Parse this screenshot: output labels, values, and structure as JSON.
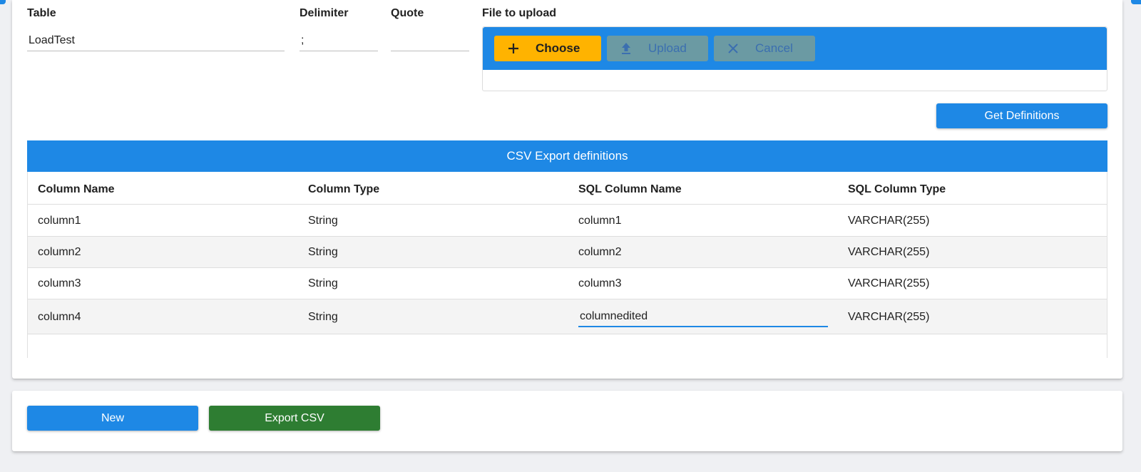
{
  "form": {
    "table_label": "Table",
    "table_value": "LoadTest",
    "delimiter_label": "Delimiter",
    "delimiter_value": ";",
    "quote_label": "Quote",
    "quote_value": "",
    "file_label": "File to upload"
  },
  "file_upload": {
    "choose_label": "Choose",
    "upload_label": "Upload",
    "cancel_label": "Cancel",
    "choose_icon": "plus-icon",
    "upload_icon": "upload-icon",
    "cancel_icon": "close-icon"
  },
  "get_definitions_label": "Get Definitions",
  "table": {
    "caption": "CSV Export definitions",
    "columns": [
      "Column Name",
      "Column Type",
      "SQL Column Name",
      "SQL Column Type"
    ],
    "rows": [
      [
        "column1",
        "String",
        "column1",
        "VARCHAR(255)"
      ],
      [
        "column2",
        "String",
        "column2",
        "VARCHAR(255)"
      ],
      [
        "column3",
        "String",
        "column3",
        "VARCHAR(255)"
      ],
      [
        "column4",
        "String",
        "columnedited",
        "VARCHAR(255)"
      ]
    ]
  },
  "footer": {
    "new_label": "New",
    "export_label": "Export CSV"
  },
  "colors": {
    "primary": "#1e88e5",
    "choose": "#ffb300",
    "disabled": "#6b9aa3",
    "export": "#2e7d32"
  }
}
